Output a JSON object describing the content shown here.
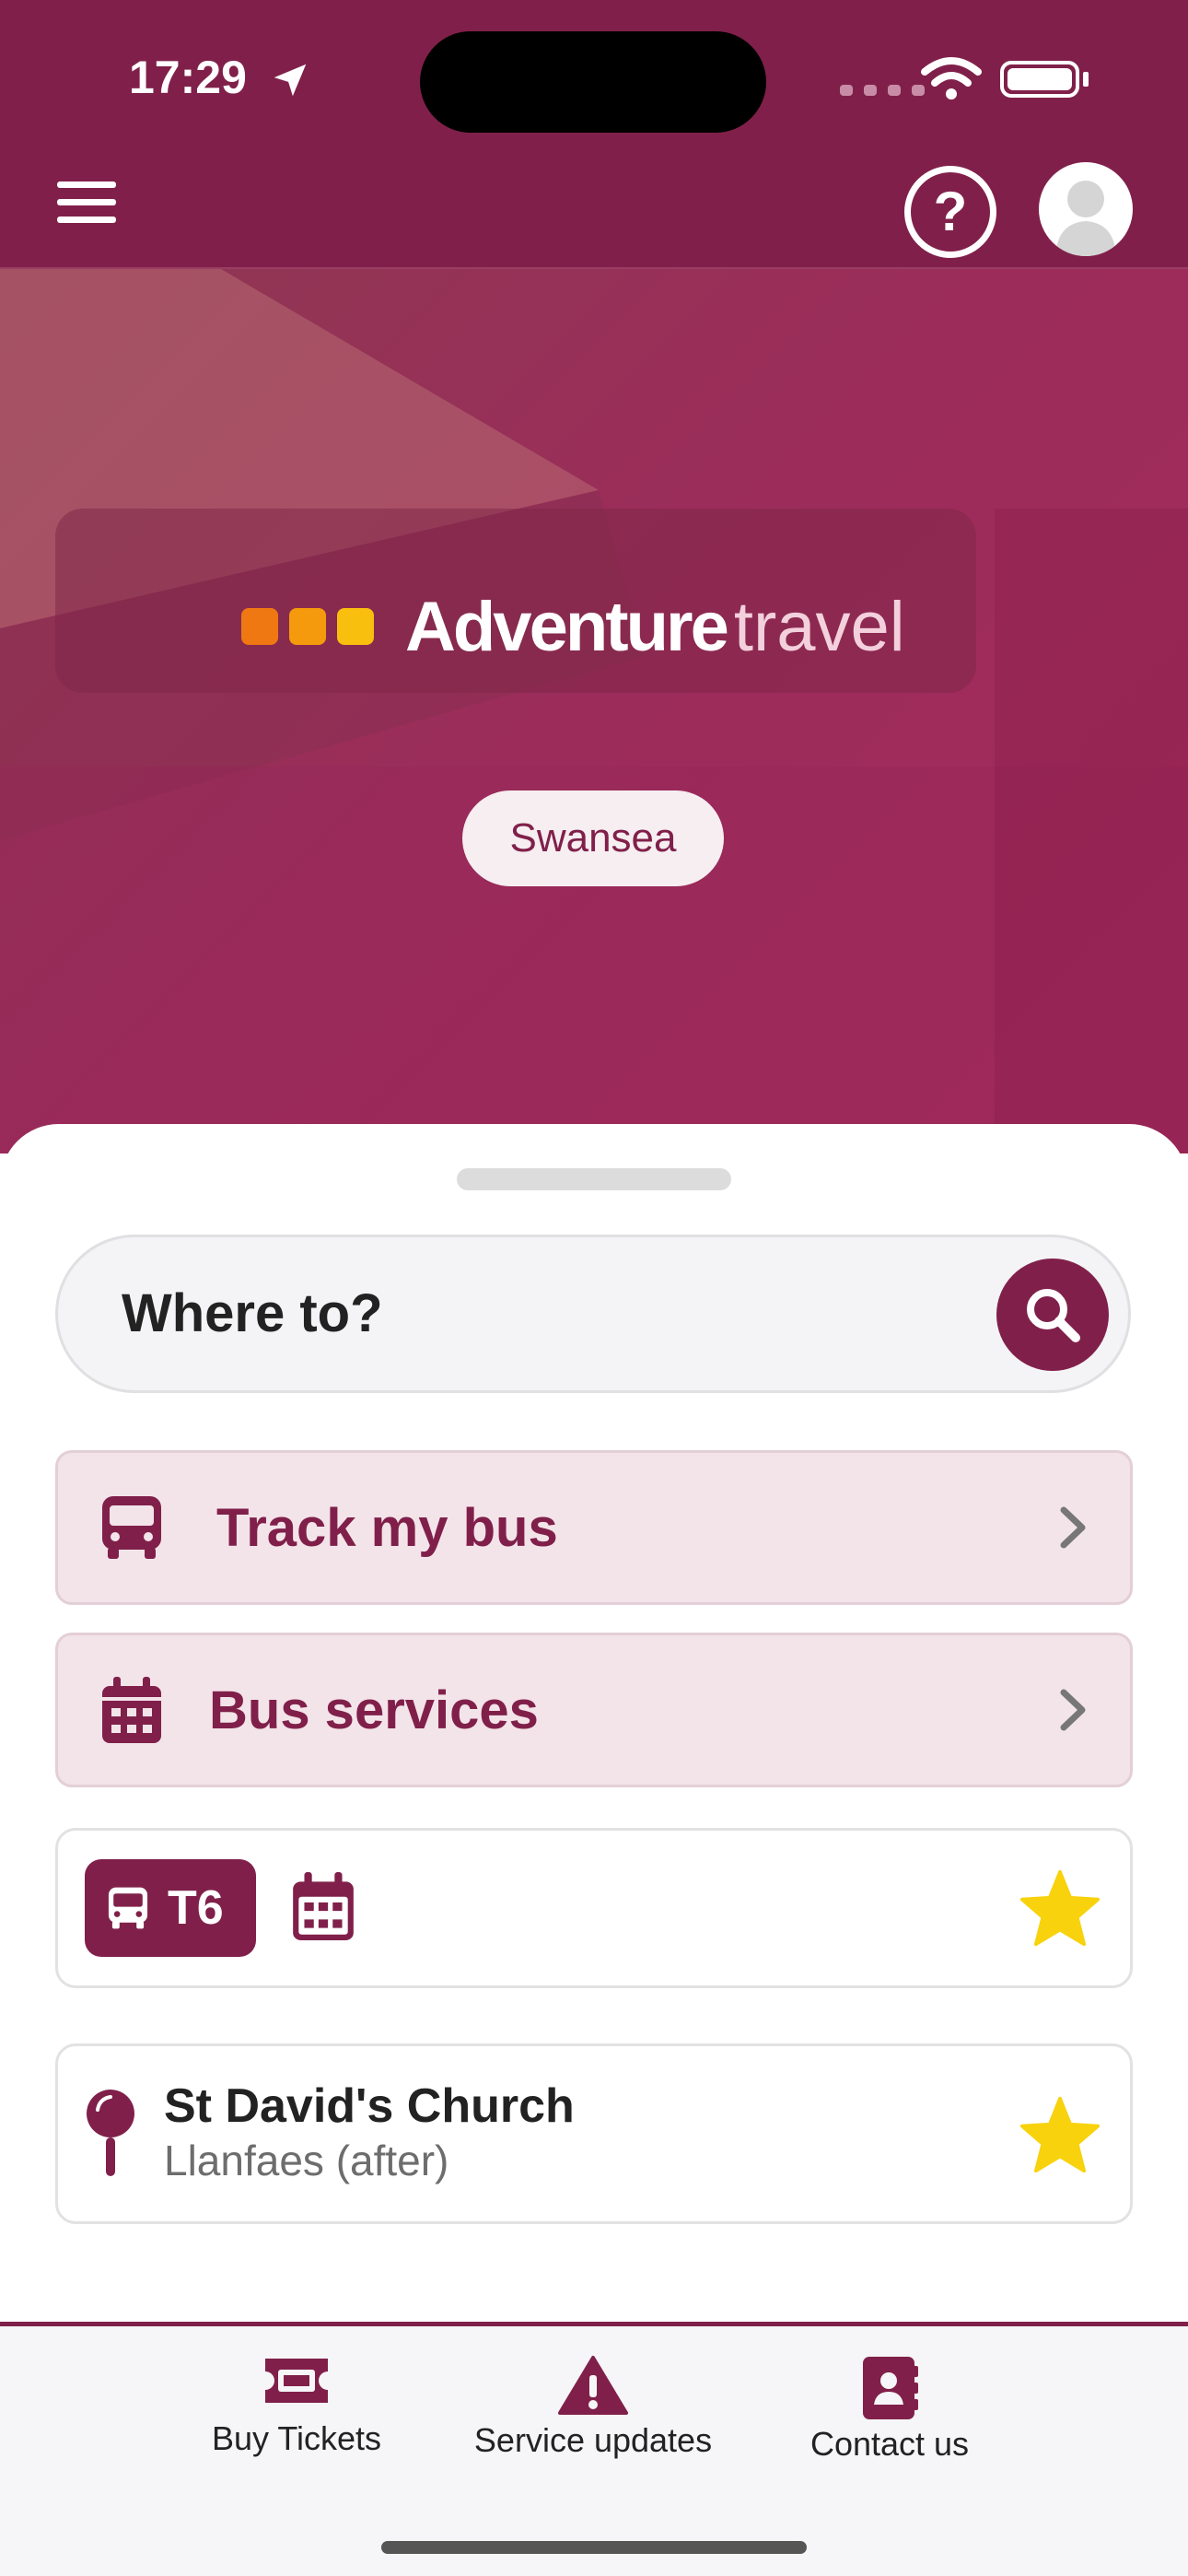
{
  "status_bar": {
    "time": "17:29"
  },
  "header": {
    "menu_icon": "hamburger-icon",
    "help_icon": "question-circle-icon",
    "profile_icon": "avatar-icon"
  },
  "hero": {
    "brand_word_bold": "Adventure",
    "brand_word_light": "travel",
    "brand_dot_colors": [
      "#f07812",
      "#f59a0c",
      "#f9bf0e"
    ],
    "city": "Swansea"
  },
  "search": {
    "label": "Where to?",
    "icon": "search-icon"
  },
  "menu": [
    {
      "label": "Track my bus",
      "icon": "bus-icon"
    },
    {
      "label": "Bus services",
      "icon": "calendar-icon"
    }
  ],
  "favourites": {
    "route": {
      "number": "T6",
      "icon": "bus-icon",
      "timetable_icon": "calendar-icon",
      "starred": true
    },
    "stop": {
      "name": "St David's Church",
      "subtitle": "Llanfaes (after)",
      "icon": "stop-pin-icon",
      "starred": true
    }
  },
  "tab_bar": [
    {
      "label": "Buy Tickets",
      "icon": "ticket-icon"
    },
    {
      "label": "Service updates",
      "icon": "warning-icon"
    },
    {
      "label": "Contact us",
      "icon": "contact-book-icon"
    }
  ],
  "colors": {
    "brand": "#80204a",
    "star": "#f8d20c"
  }
}
